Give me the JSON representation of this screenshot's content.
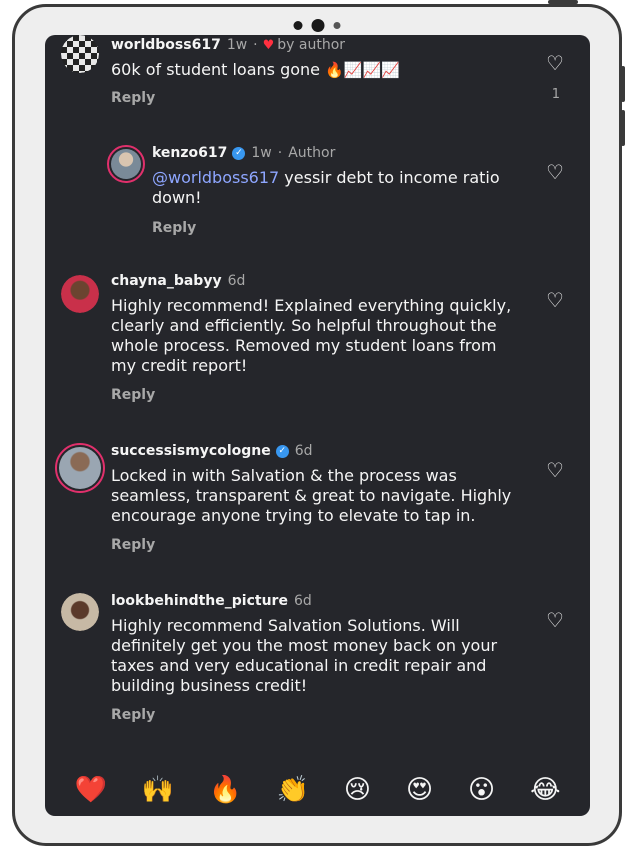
{
  "comments": [
    {
      "username": "worldboss617",
      "time": "1w",
      "author_tag": "by author",
      "text_before": "60k of student loans gone",
      "text_emoji": "🔥📈📈📈",
      "reply": "Reply",
      "likes": "1"
    },
    {
      "username": "kenzo617",
      "time": "1w",
      "author_label": "Author",
      "mention": "@worldboss617",
      "text": " yessir debt to income ratio down!",
      "reply": "Reply"
    },
    {
      "username": "chayna_babyy",
      "time": "6d",
      "text": "Highly recommend! Explained everything quickly, clearly and efficiently. So helpful throughout the whole process. Removed my student loans from my credit report!",
      "reply": "Reply"
    },
    {
      "username": "successismycologne",
      "time": "6d",
      "text": "Locked in with Salvation & the process was seamless, transparent & great to navigate. Highly encourage anyone trying to elevate to tap in.",
      "reply": "Reply"
    },
    {
      "username": "lookbehindthe_picture",
      "time": "6d",
      "text": "Highly recommend Salvation Solutions. Will definitely get you the most money back on your taxes and very educational in credit repair and building business credit!",
      "reply": "Reply"
    }
  ],
  "separator": "·",
  "verified_glyph": "✓",
  "heart_glyph": "♡",
  "red_heart_glyph": "♥",
  "emoji_bar": [
    "❤️",
    "🙌",
    "🔥",
    "👏",
    "😢",
    "😍",
    "😮",
    "😂"
  ],
  "colors": {
    "background": "#25262b",
    "mention": "#8ea6ff",
    "verified": "#3897f0",
    "like_heart": "#ff3040",
    "story_ring": "#e1306c"
  }
}
